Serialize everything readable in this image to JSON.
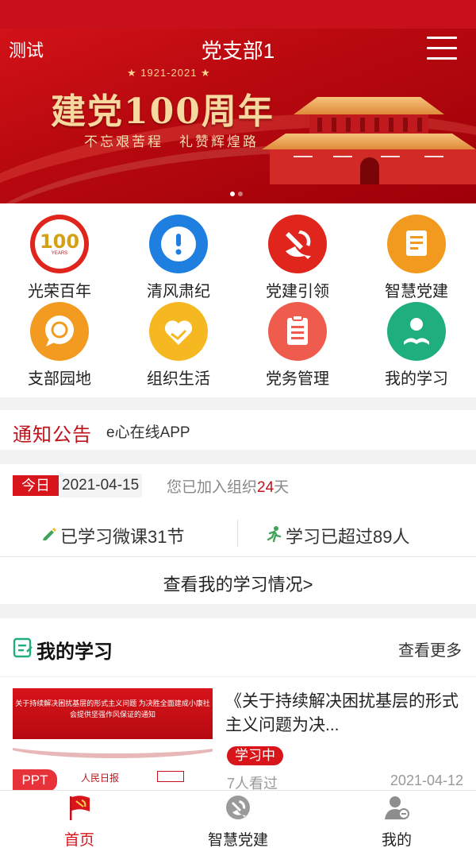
{
  "header": {
    "left_label": "测试",
    "title": "党支部1"
  },
  "banner": {
    "years": "★ 1921-2021 ★",
    "headline": "建党100周年",
    "slogan": "不忘艰苦程　礼赞辉煌路"
  },
  "grid": [
    {
      "label": "光荣百年",
      "icon": "centennial-icon",
      "color": "#e0251d"
    },
    {
      "label": "清风肃纪",
      "icon": "alert-icon",
      "color": "#1e7fe0"
    },
    {
      "label": "党建引领",
      "icon": "party-emblem-icon",
      "color": "#e0251d"
    },
    {
      "label": "智慧党建",
      "icon": "book-icon",
      "color": "#f29a1f"
    },
    {
      "label": "支部园地",
      "icon": "chat-bubble-icon",
      "color": "#f39a20"
    },
    {
      "label": "组织生活",
      "icon": "heart-hand-icon",
      "color": "#f5b820"
    },
    {
      "label": "党务管理",
      "icon": "clipboard-icon",
      "color": "#ef5c4d"
    },
    {
      "label": "我的学习",
      "icon": "reader-icon",
      "color": "#1fae7e"
    }
  ],
  "notice": {
    "heading": "通知公告",
    "text": "e心在线APP"
  },
  "stats": {
    "today_label": "今日",
    "date": "2021-04-15",
    "joined_prefix": "您已加入组织",
    "joined_days": "24",
    "joined_suffix": "天",
    "micro_courses": "已学习微课31节",
    "surpassed": "学习已超过89人",
    "view_mine": "查看我的学习情况>"
  },
  "study": {
    "title": "我的学习",
    "more": "查看更多",
    "course": {
      "thumb_text": "关于持续解决困扰基层的形式主义问题 为决胜全面建成小康社会提供坚强作风保证的通知",
      "type": "PPT",
      "title": "《关于持续解决困扰基层的形式主义问题为决...",
      "status": "学习中",
      "views": "7人看过",
      "date": "2021-04-12"
    }
  },
  "tabs": [
    {
      "label": "首页",
      "icon": "party-flag-icon",
      "active": true
    },
    {
      "label": "智慧党建",
      "icon": "hammer-sickle-icon",
      "active": false
    },
    {
      "label": "我的",
      "icon": "user-icon",
      "active": false
    }
  ],
  "colors": {
    "primary": "#d7151b",
    "text": "#222222",
    "muted": "#999999"
  }
}
